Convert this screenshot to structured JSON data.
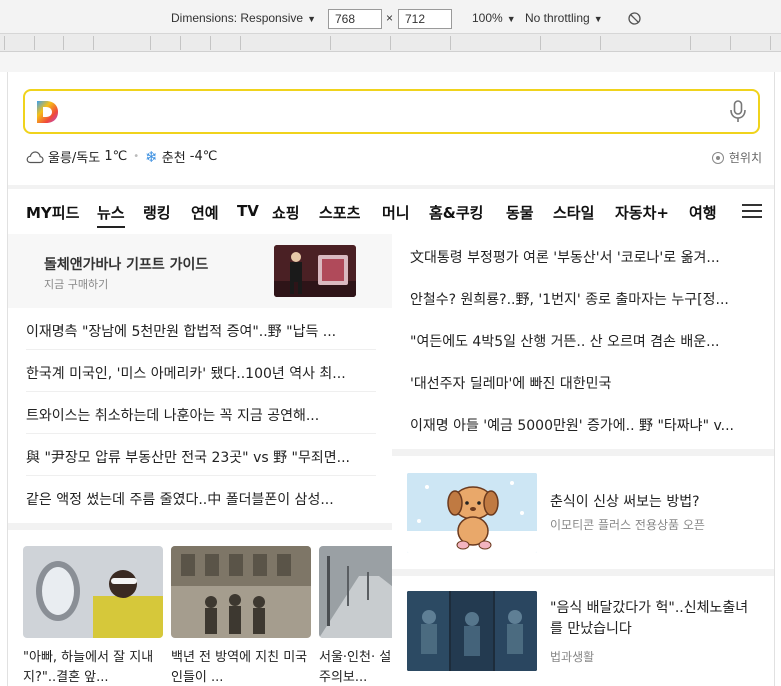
{
  "devtools": {
    "dimensions_label": "Dimensions: Responsive",
    "width_value": "768",
    "times": "×",
    "height_value": "712",
    "zoom": "100%",
    "throttling": "No throttling"
  },
  "search": {
    "placeholder": "",
    "mic_icon": "microphone-icon"
  },
  "weather": {
    "loc1": "울릉/독도",
    "temp1": "1℃",
    "loc2": "춘천",
    "temp2": "-4℃",
    "here_label": "현위치"
  },
  "tabs": [
    "MY피드",
    "뉴스",
    "랭킹",
    "연예",
    "TV",
    "쇼핑",
    "스포츠",
    "머니",
    "홈&쿠킹",
    "동물",
    "스타일",
    "자동차+",
    "여행"
  ],
  "promo": {
    "title": "돌체앤가바나 기프트 가이드",
    "subtitle": "지금 구매하기"
  },
  "left_news": [
    "이재명측 \"장남에 5천만원 합법적 증여\"..野 \"납득 ...",
    "한국계 미국인, '미스 아메리카' 됐다..100년 역사 최...",
    "트와이스는 취소하는데 나훈아는 꼭 지금 공연해...",
    "與 \"尹장모 압류 부동산만 전국 23곳\" vs 野 \"무죄면...",
    "같은 액정 썼는데 주름 줄였다..中 폴더블폰이 삼성..."
  ],
  "right_news": [
    "文대통령 부정평가 여론 '부동산'서 '코로나'로 옮겨...",
    "안철수? 원희룡?..野, '1번지' 종로 출마자는 누구[정...",
    "\"여든에도 4박5일 산행 거뜬.. 산 오르며 겸손 배운...",
    "'대선주자 딜레마'에 빠진 대한민국",
    "이재명 아들 '예금 5000만원' 증가에.. 野 \"타짜냐\" v..."
  ],
  "ad": {
    "title": "춘식이 신상 써보는 방법?",
    "subtitle": "이모티콘 플러스 전용상품 오픈"
  },
  "story": {
    "title": "\"음식 배달갔다가 헉\"..신체노출녀를 만났습니다",
    "source": "법과생활"
  },
  "photos": [
    {
      "caption": "\"아빠, 하늘에서 잘 지내지?\"..결혼 앞..."
    },
    {
      "caption": "백년 전 방역에 지친 미국인들이 ..."
    },
    {
      "caption": "서울·인천· 설주의보..."
    }
  ]
}
